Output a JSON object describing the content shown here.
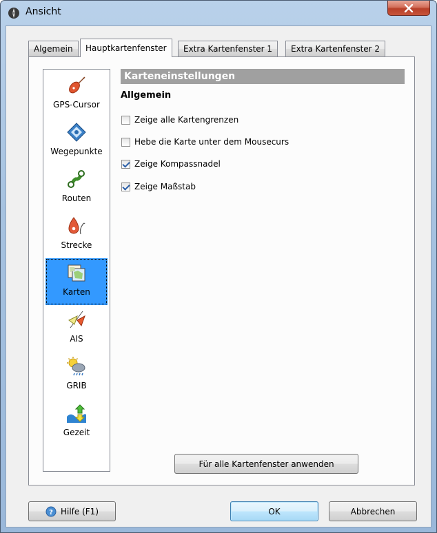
{
  "window": {
    "title": "Ansicht"
  },
  "tabs": [
    {
      "label": "Algemein",
      "active": false
    },
    {
      "label": "Hauptkartenfenster",
      "active": true
    },
    {
      "label": "Extra Kartenfenster 1",
      "active": false
    },
    {
      "label": "Extra Kartenfenster 2",
      "active": false
    }
  ],
  "sidebar": {
    "items": [
      {
        "label": "GPS-Cursor",
        "icon": "gps-cursor-icon"
      },
      {
        "label": "Wegepunkte",
        "icon": "waypoint-icon"
      },
      {
        "label": "Routen",
        "icon": "route-icon"
      },
      {
        "label": "Strecke",
        "icon": "track-icon"
      },
      {
        "label": "Karten",
        "icon": "map-icon",
        "selected": true
      },
      {
        "label": "AIS",
        "icon": "ais-icon"
      },
      {
        "label": "GRIB",
        "icon": "grib-weather-icon"
      },
      {
        "label": "Gezeit",
        "icon": "tide-icon"
      }
    ]
  },
  "main": {
    "section_title": "Karteneinstellungen",
    "group_title": "Allgemein",
    "options": [
      {
        "label": "Zeige alle Kartengrenzen",
        "checked": false
      },
      {
        "label": "Hebe die Karte unter dem Mousecurs",
        "checked": false
      },
      {
        "label": "Zeige Kompassnadel",
        "checked": true
      },
      {
        "label": "Zeige Maßstab",
        "checked": true
      }
    ],
    "apply_all_label": "Für alle Kartenfenster anwenden"
  },
  "footer": {
    "help_label": "Hilfe (F1)",
    "ok_label": "OK",
    "cancel_label": "Abbrechen"
  },
  "colors": {
    "selection": "#3399ff",
    "section_header": "#a0a0a0",
    "close_button": "#c7543a"
  }
}
